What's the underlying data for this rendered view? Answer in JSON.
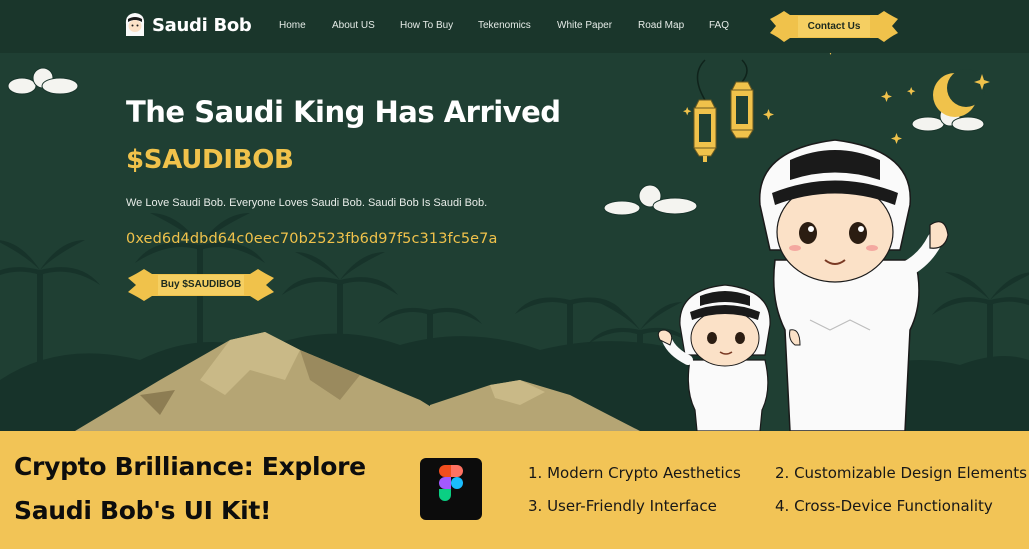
{
  "brand": {
    "name": "Saudi Bob",
    "logo_icon": "saudi-bob-avatar-icon"
  },
  "nav": {
    "items": [
      "Home",
      "About US",
      "How To Buy",
      "Tekenomics",
      "White Paper",
      "Road Map",
      "FAQ"
    ],
    "contact_label": "Contact Us"
  },
  "hero": {
    "title": "The Saudi King Has Arrived",
    "ticker": "$SAUDIBOB",
    "tagline": "We Love Saudi Bob. Everyone Loves Saudi Bob. Saudi Bob Is Saudi Bob.",
    "contract_address": "0xed6d4dbd64c0eec70b2523fb6d97f5c313fc5e7a",
    "buy_label": "Buy $SAUDIBOB"
  },
  "promo": {
    "title_line1": "Crypto Brilliance: Explore",
    "title_line2": "Saudi Bob's UI Kit!",
    "tool_icon": "figma-logo-icon",
    "features": [
      "1. Modern Crypto Aesthetics",
      "2. Customizable Design Elements",
      "3. User-Friendly Interface",
      "4. Cross-Device Functionality"
    ]
  },
  "colors": {
    "hero_bg": "#1f3f33",
    "nav_bg": "#1a362b",
    "accent_gold": "#f0c24b",
    "promo_bg": "#f2c456"
  }
}
